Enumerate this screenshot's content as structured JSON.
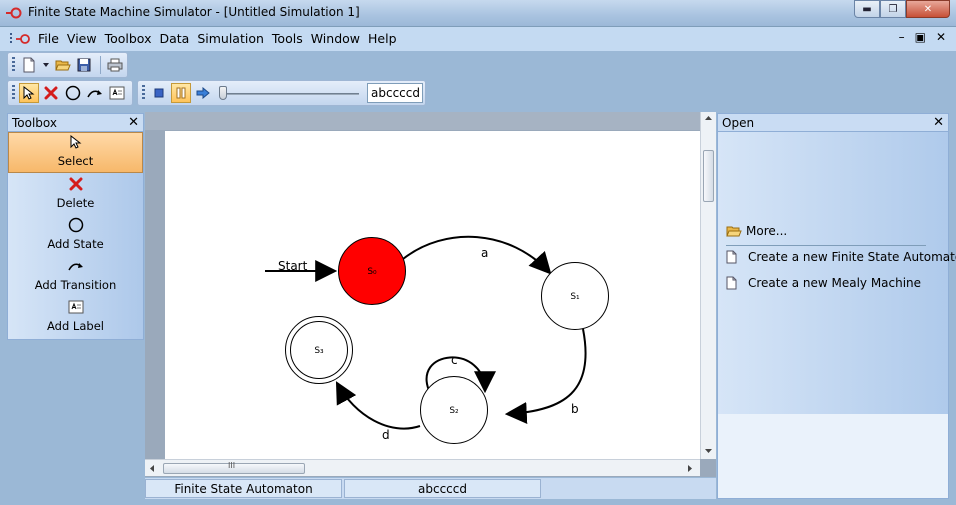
{
  "window": {
    "title": "Finite State Machine Simulator - [Untitled Simulation 1]",
    "minimize": "▬",
    "restore": "❐",
    "close": "✕"
  },
  "menu": {
    "items": [
      "File",
      "View",
      "Toolbox",
      "Data",
      "Simulation",
      "Tools",
      "Window",
      "Help"
    ],
    "mdi_minimize": "–",
    "mdi_restore": "▣",
    "mdi_close": "✕"
  },
  "simulation": {
    "input_string": "abccccd"
  },
  "toolbox": {
    "title": "Toolbox",
    "close": "✕",
    "tools": [
      {
        "label": "Select",
        "icon": "pointer-icon",
        "active": true
      },
      {
        "label": "Delete",
        "icon": "red-x-icon",
        "active": false
      },
      {
        "label": "Add State",
        "icon": "circle-icon",
        "active": false
      },
      {
        "label": "Add Transition",
        "icon": "curved-arrow-icon",
        "active": false
      },
      {
        "label": "Add Label",
        "icon": "label-icon",
        "active": false
      }
    ]
  },
  "diagram": {
    "start_label": "Start",
    "states": [
      {
        "name": "S₀",
        "active": true,
        "accepting": false
      },
      {
        "name": "S₁",
        "active": false,
        "accepting": false
      },
      {
        "name": "S₂",
        "active": false,
        "accepting": false
      },
      {
        "name": "S₃",
        "active": false,
        "accepting": true
      }
    ],
    "transitions": [
      {
        "from": "S₀",
        "to": "S₁",
        "label": "a"
      },
      {
        "from": "S₁",
        "to": "S₂",
        "label": "b"
      },
      {
        "from": "S₂",
        "to": "S₂",
        "label": "c"
      },
      {
        "from": "S₂",
        "to": "S₃",
        "label": "d"
      }
    ],
    "colors": {
      "active_state": "#ff0000",
      "state": "#ffffff",
      "stroke": "#000000"
    }
  },
  "canvas": {
    "hscroll_grip": "III"
  },
  "status": {
    "machine_type": "Finite State Automaton",
    "input": "abccccd"
  },
  "open_panel": {
    "title": "Open",
    "close": "✕",
    "more": "More...",
    "links": [
      "Create a new Finite State Automaton",
      "Create a new Mealy Machine"
    ]
  }
}
